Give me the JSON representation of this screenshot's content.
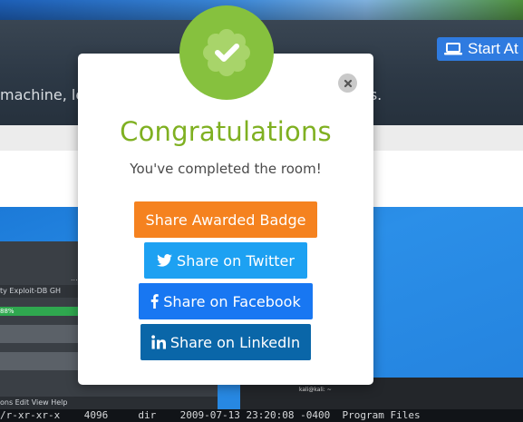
{
  "background": {
    "start_button_label": "Start At",
    "hero_text_left": "machine, le",
    "hero_text_right": "es.",
    "toolbar_text": "ty   Exploit-DB   GH",
    "progress_text": "88%",
    "menu_text": "ons  Edit  View  Help",
    "terminal_line": "/r-xr-xr-x    4096     dir    2009-07-13 23:20:08 -0400  Program Files",
    "hostname": "kali@kali: ~",
    "dots": "..."
  },
  "modal": {
    "title": "Congratulations",
    "subtitle": "You've completed the room!",
    "close_icon": "close-icon",
    "badge_icon": "checkmark-badge-icon",
    "colors": {
      "badge_green": "#86c13e",
      "title_green": "#7fb021",
      "orange": "#f5821f",
      "twitter": "#1da1f2",
      "facebook": "#1877f2",
      "linkedin": "#0a66a8"
    },
    "buttons": {
      "badge": {
        "label": "Share Awarded Badge"
      },
      "twitter": {
        "label": "Share on Twitter",
        "icon": "twitter-icon"
      },
      "facebook": {
        "label": "Share on Facebook",
        "icon": "facebook-icon"
      },
      "linkedin": {
        "label": "Share on LinkedIn",
        "icon": "linkedin-icon"
      }
    }
  }
}
